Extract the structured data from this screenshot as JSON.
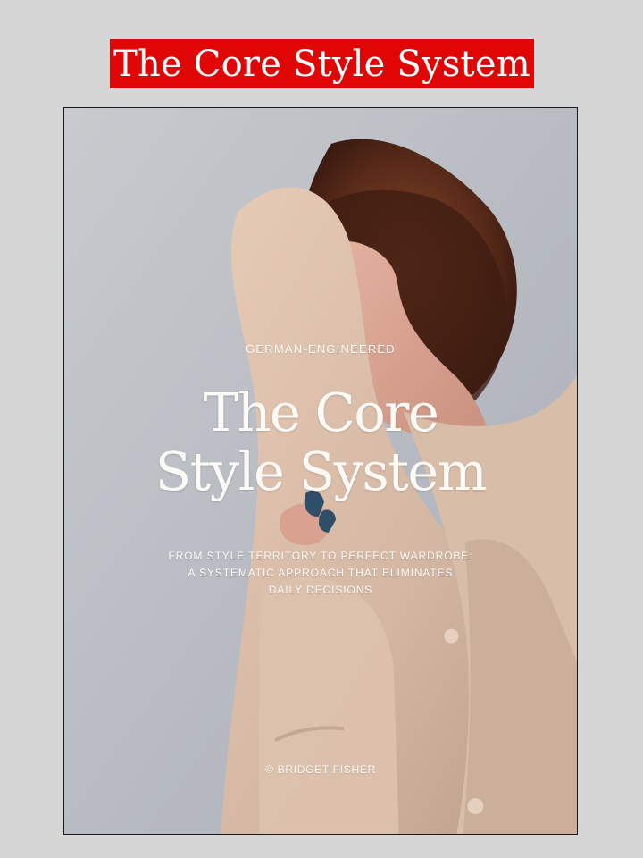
{
  "header": {
    "title": "The Core Style System"
  },
  "cover": {
    "kicker": "GERMAN-ENGINEERED",
    "title_line_1": "The Core",
    "title_line_2": "Style System",
    "subtitle_line_1": "FROM STYLE TERRITORY TO PERFECT WARDROBE:",
    "subtitle_line_2": "A SYSTEMATIC APPROACH THAT ELIMINATES",
    "subtitle_line_3": "DAILY DECISIONS",
    "author": "© BRIDGET FISHER"
  },
  "colors": {
    "page_background": "#d6d6d6",
    "banner_red": "#e10606",
    "cover_text": "#fbfaf7",
    "coat_beige": "#d9bea9",
    "hair_brown": "#4b2416",
    "skin_tone": "#d8a796"
  }
}
